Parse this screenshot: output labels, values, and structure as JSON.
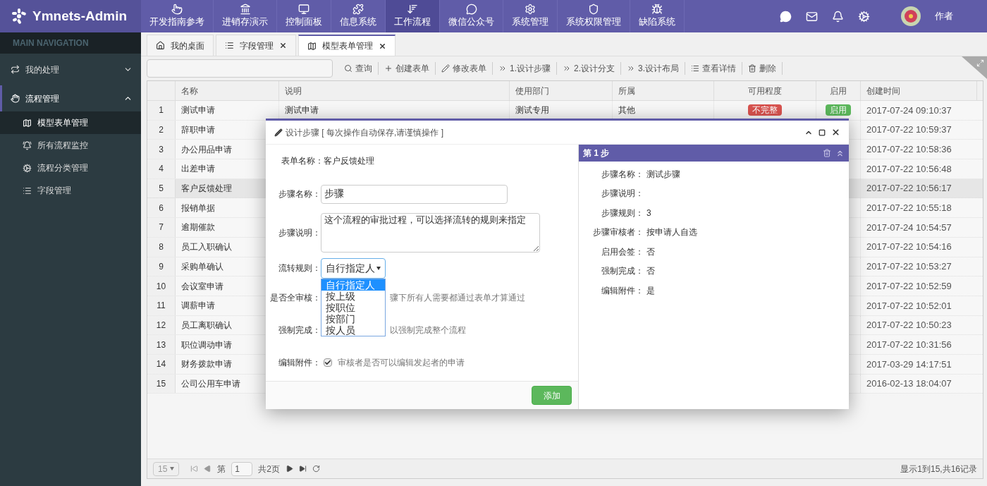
{
  "app": {
    "logo": "Ymnets-Admin"
  },
  "top_nav": [
    {
      "label": "开发指南参考",
      "selected": false
    },
    {
      "label": "进销存演示",
      "selected": false
    },
    {
      "label": "控制面板",
      "selected": false
    },
    {
      "label": "信息系统",
      "selected": false
    },
    {
      "label": "工作流程",
      "selected": true
    },
    {
      "label": "微信公众号",
      "selected": false
    },
    {
      "label": "系统管理",
      "selected": false
    },
    {
      "label": "系统权限管理",
      "selected": false
    },
    {
      "label": "缺陷系统",
      "selected": false
    }
  ],
  "user": {
    "name": "作者"
  },
  "sidebar": {
    "heading": "MAIN NAVIGATION",
    "items": [
      {
        "label": "我的处理",
        "expanded": false
      },
      {
        "label": "流程管理",
        "expanded": true,
        "children": [
          {
            "label": "模型表单管理",
            "selected": true
          },
          {
            "label": "所有流程监控",
            "selected": false
          },
          {
            "label": "流程分类管理",
            "selected": false
          },
          {
            "label": "字段管理",
            "selected": false
          }
        ]
      }
    ]
  },
  "tabs": [
    {
      "label": "我的桌面",
      "selected": false,
      "closable": false
    },
    {
      "label": "字段管理",
      "selected": false,
      "closable": true
    },
    {
      "label": "模型表单管理",
      "selected": true,
      "closable": true
    }
  ],
  "toolbar": [
    "查询",
    "创建表单",
    "修改表单",
    "1.设计步骤",
    "2.设计分支",
    "3.设计布局",
    "查看详情",
    "删除"
  ],
  "table": {
    "columns": [
      "名称",
      "说明",
      "使用部门",
      "所属",
      "可用程度",
      "启用",
      "创建时间"
    ],
    "rows": [
      {
        "no": "1",
        "name": "测试申请",
        "description": "测试申请",
        "department": "测试专用",
        "category": "其他",
        "completeness": {
          "text": "不完整",
          "color": "#d9534f"
        },
        "enabled": {
          "text": "启用",
          "color": "#5cb85c"
        },
        "created": "2017-07-24 09:10:37",
        "selected": false
      },
      {
        "no": "2",
        "name": "辞职申请",
        "created": "2017-07-22 10:59:37",
        "selected": false
      },
      {
        "no": "3",
        "name": "办公用品申请",
        "created": "2017-07-22 10:58:36",
        "selected": false
      },
      {
        "no": "4",
        "name": "出差申请",
        "created": "2017-07-22 10:56:48",
        "selected": false
      },
      {
        "no": "5",
        "name": "客户反馈处理",
        "created": "2017-07-22 10:56:17",
        "selected": true
      },
      {
        "no": "6",
        "name": "报销单据",
        "created": "2017-07-22 10:55:18",
        "selected": false
      },
      {
        "no": "7",
        "name": "逾期催款",
        "created": "2017-07-24 10:54:57",
        "selected": false
      },
      {
        "no": "8",
        "name": "员工入职确认",
        "created": "2017-07-22 10:54:16",
        "selected": false
      },
      {
        "no": "9",
        "name": "采购单确认",
        "created": "2017-07-22 10:53:27",
        "selected": false
      },
      {
        "no": "10",
        "name": "会议室申请",
        "created": "2017-07-22 10:52:59",
        "selected": false
      },
      {
        "no": "11",
        "name": "调薪申请",
        "created": "2017-07-22 10:52:01",
        "selected": false
      },
      {
        "no": "12",
        "name": "员工离职确认",
        "created": "2017-07-22 10:50:23",
        "selected": false
      },
      {
        "no": "13",
        "name": "职位调动申请",
        "created": "2017-07-22 10:31:56",
        "selected": false
      },
      {
        "no": "14",
        "name": "财务拨款申请",
        "created": "2017-03-29 14:17:51",
        "selected": false
      },
      {
        "no": "15",
        "name": "公司公用车申请",
        "created": "2016-02-13 18:04:07",
        "selected": false
      }
    ]
  },
  "pager": {
    "page_size": "15",
    "page_prefix": "第",
    "page": "1",
    "total_pages": "共2页",
    "summary": "显示1到15,共16记录"
  },
  "dialog": {
    "title": "设计步骤 [ 每次操作自动保存,请谨慎操作 ]",
    "form_name": {
      "label": "表单名称：",
      "value": "客户反馈处理"
    },
    "step_name": {
      "label": "步骤名称：",
      "value": "步骤"
    },
    "step_desc": {
      "label": "步骤说明：",
      "value": "这个流程的审批过程，可以选择流转的规则来指定"
    },
    "rule": {
      "label": "流转规则：",
      "value": "自行指定人",
      "expanded": true,
      "options": [
        {
          "label": "自行指定人",
          "selected": true
        },
        {
          "label": "按上级",
          "selected": false
        },
        {
          "label": "按职位",
          "selected": false
        },
        {
          "label": "按部门",
          "selected": false
        },
        {
          "label": "按人员",
          "selected": false
        }
      ]
    },
    "all_review": {
      "label": "是否全审核：",
      "hint": "骤下所有人需要都通过表单才算通过"
    },
    "force": {
      "label": "强制完成：",
      "hint": "以强制完成整个流程"
    },
    "edit_attach": {
      "label": "编辑附件：",
      "checked": true,
      "hint": "审核者是否可以编辑发起者的申请"
    },
    "add_button": "添加",
    "step_panel": {
      "title": "第 1 步",
      "details": [
        {
          "label": "步骤名称：",
          "value": "测试步骤"
        },
        {
          "label": "步骤说明："
        },
        {
          "label": "步骤规则：",
          "value": "3"
        },
        {
          "label": "步骤审核者：",
          "value": "按申请人自选"
        },
        {
          "label": "启用会签：",
          "value": "否"
        },
        {
          "label": "强制完成：",
          "value": "否"
        },
        {
          "label": "编辑附件：",
          "value": "是"
        }
      ]
    }
  }
}
